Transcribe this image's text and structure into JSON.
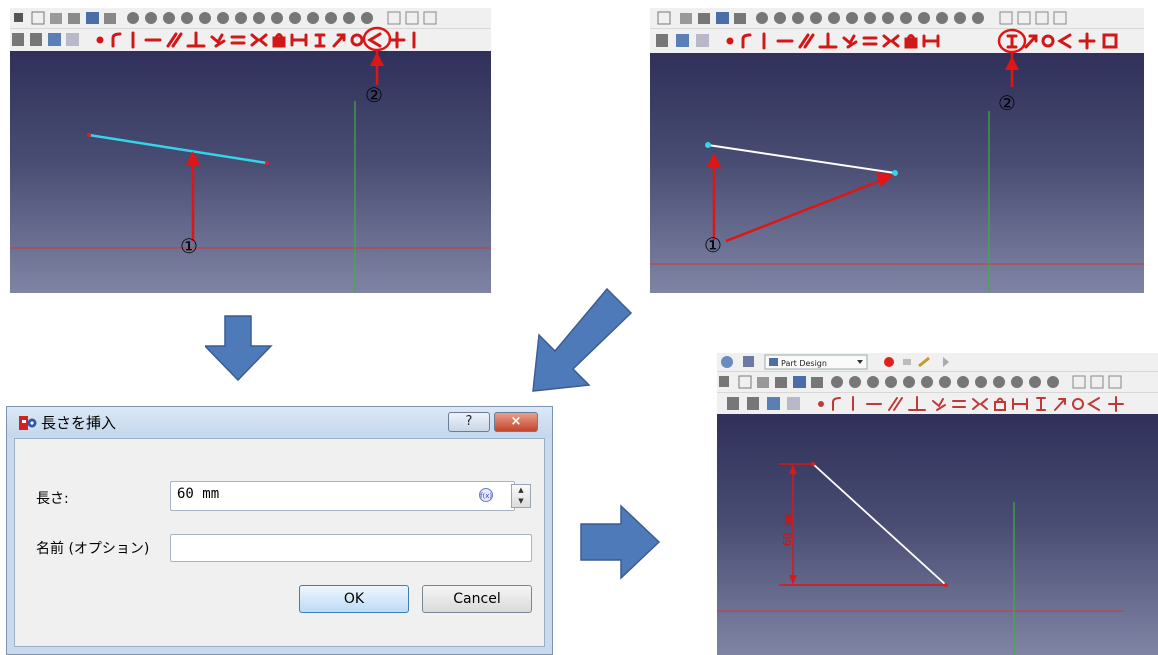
{
  "panels": {
    "top_left": {
      "marker_1": "①",
      "marker_2": "②"
    },
    "top_right": {
      "marker_1": "①",
      "marker_2": "②"
    },
    "bottom_right": {
      "workbench_label": "Part Design",
      "dimension_label": "60 mm"
    }
  },
  "dialog": {
    "title": "長さを挿入",
    "help_label": "?",
    "close_label": "×",
    "length_label": "長さ:",
    "length_value": "60 mm",
    "fx_label": "f(x)",
    "name_label": "名前 (オプション)",
    "name_value": "",
    "ok_label": "OK",
    "cancel_label": "Cancel"
  },
  "colors": {
    "arrow_fill": "#4f7ab9",
    "annotation_red": "#e01515",
    "selected_line": "#33d5e8",
    "axis_red": "#c83a3a",
    "axis_green": "#3fae3f"
  },
  "icons": [
    "sketcher-toolbar-icons",
    "constrain-vertical-distance-icon",
    "red-arrow-icon",
    "big-flow-arrow-icon"
  ]
}
